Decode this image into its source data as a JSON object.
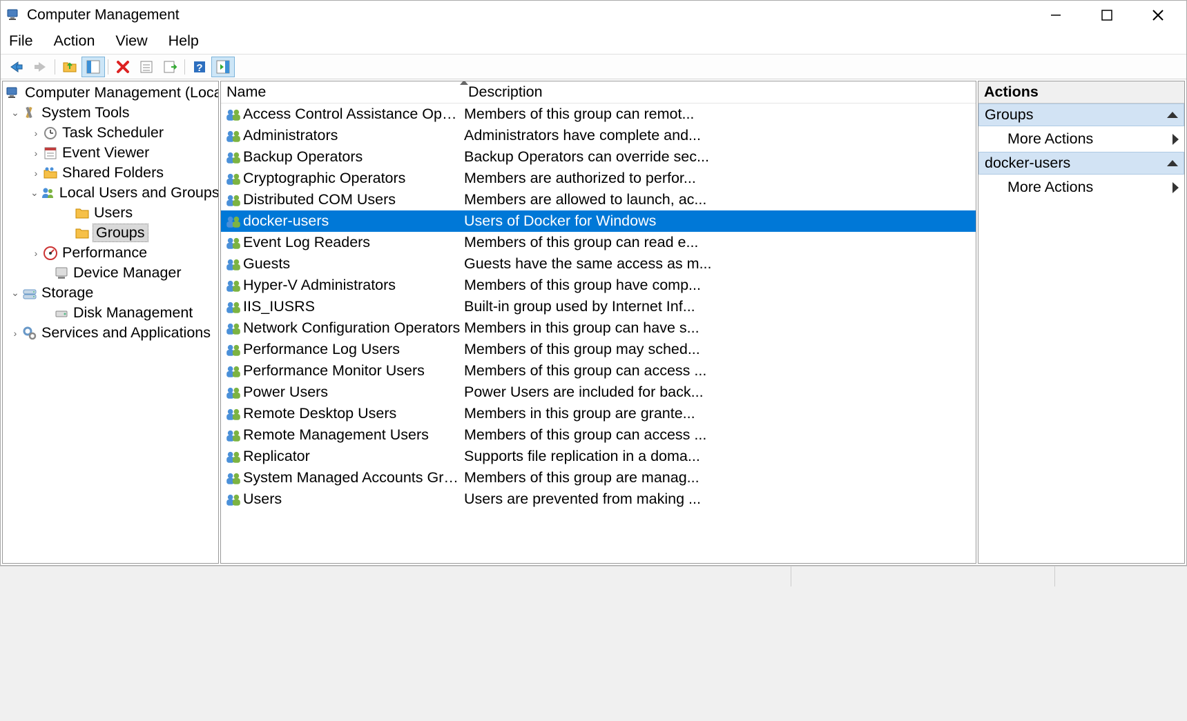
{
  "window": {
    "title": "Computer Management"
  },
  "menubar": [
    "File",
    "Action",
    "View",
    "Help"
  ],
  "tree": {
    "root": "Computer Management (Local)",
    "nodes": {
      "system_tools": "System Tools",
      "task_scheduler": "Task Scheduler",
      "event_viewer": "Event Viewer",
      "shared_folders": "Shared Folders",
      "local_users_groups": "Local Users and Groups",
      "users": "Users",
      "groups": "Groups",
      "performance": "Performance",
      "device_manager": "Device Manager",
      "storage": "Storage",
      "disk_management": "Disk Management",
      "services_apps": "Services and Applications"
    }
  },
  "columns": {
    "name": "Name",
    "description": "Description"
  },
  "groups": [
    {
      "name": "Access Control Assistance Operators",
      "desc": "Members of this group can remot..."
    },
    {
      "name": "Administrators",
      "desc": "Administrators have complete and..."
    },
    {
      "name": "Backup Operators",
      "desc": "Backup Operators can override sec..."
    },
    {
      "name": "Cryptographic Operators",
      "desc": "Members are authorized to perfor..."
    },
    {
      "name": "Distributed COM Users",
      "desc": "Members are allowed to launch, ac..."
    },
    {
      "name": "docker-users",
      "desc": "Users of Docker for Windows",
      "selected": true
    },
    {
      "name": "Event Log Readers",
      "desc": "Members of this group can read e..."
    },
    {
      "name": "Guests",
      "desc": "Guests have the same access as m..."
    },
    {
      "name": "Hyper-V Administrators",
      "desc": "Members of this group have comp..."
    },
    {
      "name": "IIS_IUSRS",
      "desc": "Built-in group used by Internet Inf..."
    },
    {
      "name": "Network Configuration Operators",
      "desc": "Members in this group can have s..."
    },
    {
      "name": "Performance Log Users",
      "desc": "Members of this group may sched..."
    },
    {
      "name": "Performance Monitor Users",
      "desc": "Members of this group can access ..."
    },
    {
      "name": "Power Users",
      "desc": "Power Users are included for back..."
    },
    {
      "name": "Remote Desktop Users",
      "desc": "Members in this group are grante..."
    },
    {
      "name": "Remote Management Users",
      "desc": "Members of this group can access ..."
    },
    {
      "name": "Replicator",
      "desc": "Supports file replication in a doma..."
    },
    {
      "name": "System Managed Accounts Group",
      "desc": "Members of this group are manag..."
    },
    {
      "name": "Users",
      "desc": "Users are prevented from making ..."
    }
  ],
  "actions": {
    "header": "Actions",
    "section1": "Groups",
    "more1": "More Actions",
    "section2": "docker-users",
    "more2": "More Actions"
  }
}
